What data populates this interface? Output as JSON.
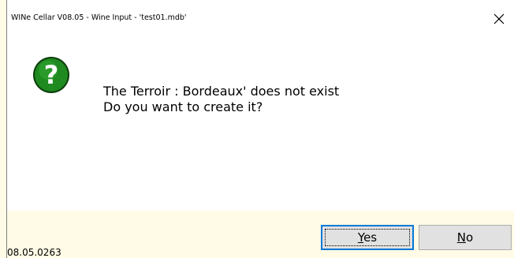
{
  "window": {
    "title": "WINe Cellar V08.05  - Wine Input -  'test01.mdb'"
  },
  "dialog": {
    "icon": "question-icon",
    "message_line1": "The Terroir : Bordeaux' does not exist",
    "message_line2": "Do you want to create it?"
  },
  "buttons": {
    "yes_accel": "Y",
    "yes_rest": "es",
    "no_accel": "N",
    "no_rest": "o"
  },
  "footer": {
    "version": "08.05.0263"
  },
  "colors": {
    "footer_bg": "#fffbe6",
    "icon_green": "#1f8a1f",
    "default_button_border": "#0078d7"
  }
}
